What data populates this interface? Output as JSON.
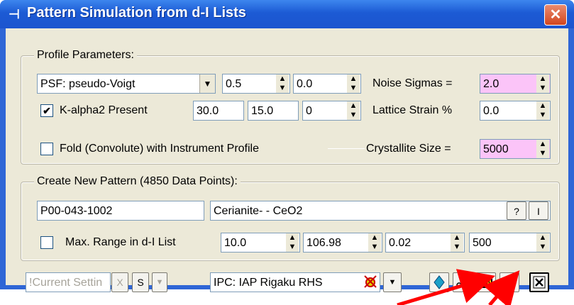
{
  "window": {
    "title": "Pattern Simulation from d-I Lists",
    "close_glyph": "✕",
    "icon": "app-icon"
  },
  "profile": {
    "legend": "Profile Parameters:",
    "psf_select": "PSF: pseudo-Voigt",
    "psf_param1": "0.5",
    "psf_param2": "0.0",
    "noise_label": "Noise Sigmas =",
    "noise_value": "2.0",
    "kalpha_checked": true,
    "kalpha_label": "K-alpha2 Present",
    "kalpha_v1": "30.0",
    "kalpha_v2": "15.0",
    "kalpha_v3": "0",
    "strain_label": "Lattice Strain %",
    "strain_value": "0.0",
    "fold_checked": false,
    "fold_label": "Fold (Convolute) with Instrument Profile",
    "cryst_label": "Crystallite Size =",
    "cryst_value": "5000"
  },
  "create": {
    "legend": "Create New Pattern (4850 Data Points):",
    "pdf_id": "P00-043-1002",
    "phase_name": "Cerianite- - CeO2",
    "help_label": "?",
    "info_label": "I",
    "maxrange_checked": false,
    "maxrange_label": "Max. Range in d-I List",
    "r1": "10.0",
    "r2": "106.98",
    "r3": "0.02",
    "r4": "500"
  },
  "bottom": {
    "settings_placeholder": "!Current Settin",
    "x_label": "X",
    "s_label": "S",
    "ipc_select": "IPC: IAP Rigaku RHS"
  },
  "colors": {
    "accent_pink": "#fbc4f8",
    "title_blue": "#1c5ad4",
    "annotation_red": "#ff0000"
  }
}
